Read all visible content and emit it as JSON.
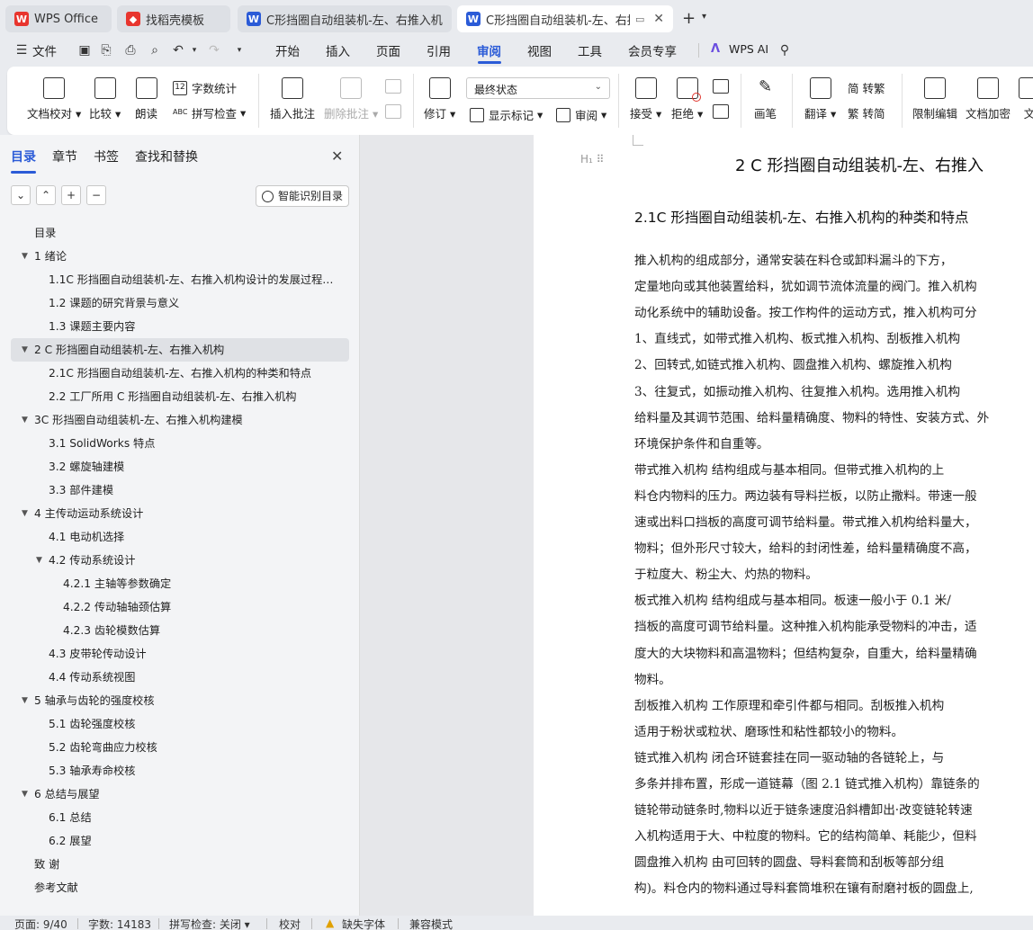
{
  "tabs": [
    {
      "label": "WPS Office",
      "icon": "wps-logo-icon"
    },
    {
      "label": "找稻壳模板",
      "icon": "docer-logo-icon"
    },
    {
      "label": "C形挡圈自动组装机-左、右推入机构设",
      "icon": "writer-icon"
    },
    {
      "label": "C形挡圈自动组装机-左、右推",
      "icon": "writer-icon"
    }
  ],
  "menu": {
    "file": "文件",
    "items": [
      "开始",
      "插入",
      "页面",
      "引用",
      "审阅",
      "视图",
      "工具",
      "会员专享"
    ],
    "active": "审阅",
    "ai": "WPS AI"
  },
  "ribbon": {
    "doc_check": "文档校对",
    "compare": "比较",
    "read_aloud": "朗读",
    "word_count": "字数统计",
    "spell_check": "拼写检查",
    "insert_comment": "插入批注",
    "delete_comment": "删除批注",
    "revise": "修订",
    "track_state": "最终状态",
    "show_markup": "显示标记",
    "review": "审阅",
    "accept": "接受",
    "reject": "拒绝",
    "pen": "画笔",
    "translate": "翻译",
    "to_traditional": "简 转繁",
    "to_simplified": "繁 转简",
    "restrict_edit": "限制编辑",
    "doc_encrypt": "文档加密",
    "doc_more": "文"
  },
  "panel": {
    "tabs": [
      "目录",
      "章节",
      "书签",
      "查找和替换"
    ],
    "smart_toc": "智能识别目录",
    "toc": [
      {
        "text": "目录",
        "level": 1,
        "arrow": false
      },
      {
        "text": "1   绪论",
        "level": 1,
        "arrow": true
      },
      {
        "text": "1.1C 形挡圈自动组装机-左、右推入机构设计的发展过程及 ...",
        "level": 2,
        "arrow": false
      },
      {
        "text": "1.2 课题的研究背景与意义",
        "level": 2,
        "arrow": false
      },
      {
        "text": "1.3 课题主要内容",
        "level": 2,
        "arrow": false
      },
      {
        "text": "2   C 形挡圈自动组装机-左、右推入机构",
        "level": 1,
        "arrow": true,
        "selected": true
      },
      {
        "text": "2.1C 形挡圈自动组装机-左、右推入机构的种类和特点",
        "level": 2,
        "arrow": false
      },
      {
        "text": "2.2 工厂所用 C 形挡圈自动组装机-左、右推入机构",
        "level": 2,
        "arrow": false
      },
      {
        "text": "3C 形挡圈自动组装机-左、右推入机构建模",
        "level": 1,
        "arrow": true
      },
      {
        "text": "3.1 SolidWorks 特点",
        "level": 2,
        "arrow": false
      },
      {
        "text": "3.2 螺旋轴建模",
        "level": 2,
        "arrow": false
      },
      {
        "text": "3.3 部件建模",
        "level": 2,
        "arrow": false
      },
      {
        "text": "4   主传动运动系统设计",
        "level": 1,
        "arrow": true
      },
      {
        "text": "4.1 电动机选择",
        "level": 2,
        "arrow": false
      },
      {
        "text": "4.2 传动系统设计",
        "level": 2,
        "arrow": true
      },
      {
        "text": "4.2.1 主轴等参数确定",
        "level": 3,
        "arrow": false
      },
      {
        "text": "4.2.2 传动轴轴颈估算",
        "level": 3,
        "arrow": false
      },
      {
        "text": "4.2.3 齿轮模数估算",
        "level": 3,
        "arrow": false
      },
      {
        "text": "4.3 皮带轮传动设计",
        "level": 2,
        "arrow": false
      },
      {
        "text": "4.4 传动系统视图",
        "level": 2,
        "arrow": false
      },
      {
        "text": "5  轴承与齿轮的强度校核",
        "level": 1,
        "arrow": true
      },
      {
        "text": "5.1 齿轮强度校核",
        "level": 2,
        "arrow": false
      },
      {
        "text": "5.2 齿轮弯曲应力校核",
        "level": 2,
        "arrow": false
      },
      {
        "text": "5.3 轴承寿命校核",
        "level": 2,
        "arrow": false
      },
      {
        "text": "6 总结与展望",
        "level": 1,
        "arrow": true
      },
      {
        "text": "6.1 总结",
        "level": 2,
        "arrow": false
      },
      {
        "text": "6.2 展望",
        "level": 2,
        "arrow": false
      },
      {
        "text": "致   谢",
        "level": 1,
        "arrow": false
      },
      {
        "text": "参考文献",
        "level": 1,
        "arrow": false
      }
    ]
  },
  "document": {
    "heading1": "2   C 形挡圈自动组装机-左、右推入",
    "heading2": "2.1C 形挡圈自动组装机-左、右推入机构的种类和特点",
    "lines": [
      "      推入机构的组成部分，通常安装在料仓或卸料漏斗的下方，",
      "定量地向或其他装置给料，犹如调节流体流量的阀门。推入机构",
      "动化系统中的辅助设备。按工作构件的运动方式，推入机构可分",
      "      1、直线式，如带式推入机构、板式推入机构、刮板推入机构",
      "      2、回转式,如链式推入机构、圆盘推入机构、螺旋推入机构",
      "      3、往复式，如振动推入机构、往复推入机构。选用推入机构",
      "给料量及其调节范围、给料量精确度、物料的特性、安装方式、外",
      "环境保护条件和自重等。",
      "      带式推入机构  结构组成与基本相同。但带式推入机构的上",
      "料仓内物料的压力。两边装有导料拦板，以防止撒料。带速一般",
      "速或出料口挡板的高度可调节给料量。带式推入机构给料量大，",
      "物料；但外形尺寸较大，给料的封闭性差，给料量精确度不高，",
      "于粒度大、粉尘大、灼热的物料。",
      "      板式推入机构  结构组成与基本相同。板速一般小于  0.1 米/",
      "挡板的高度可调节给料量。这种推入机构能承受物料的冲击，适",
      "度大的大块物料和高温物料；但结构复杂，自重大，给料量精确",
      "物料。",
      "      刮板推入机构  工作原理和牵引件都与相同。刮板推入机构",
      "适用于粉状或粒状、磨琢性和粘性都较小的物料。",
      "      链式推入机构  闭合环链套挂在同一驱动轴的各链轮上，与",
      "多条并排布置，形成一道链幕（图 2.1  链式推入机构）靠链条的",
      "链轮带动链条时,物料以近于链条速度沿斜槽卸出·改变链轮转速",
      "入机构适用于大、中粒度的物料。它的结构简单、耗能少，但料",
      "      圆盘推入机构  由可回转的圆盘、导料套筒和刮板等部分组",
      "构)。料仓内的物料通过导料套筒堆积在镶有耐磨衬板的圆盘上,"
    ]
  },
  "status": {
    "page": "页面: 9/40",
    "words": "字数: 14183",
    "spell": "拼写检查: 关闭",
    "proof": "校对",
    "missing_font": "缺失字体",
    "compat": "兼容模式"
  },
  "colors": {
    "accent": "#2b5bd7",
    "wps_red": "#e8352e",
    "writer_blue": "#2b5bd7"
  }
}
